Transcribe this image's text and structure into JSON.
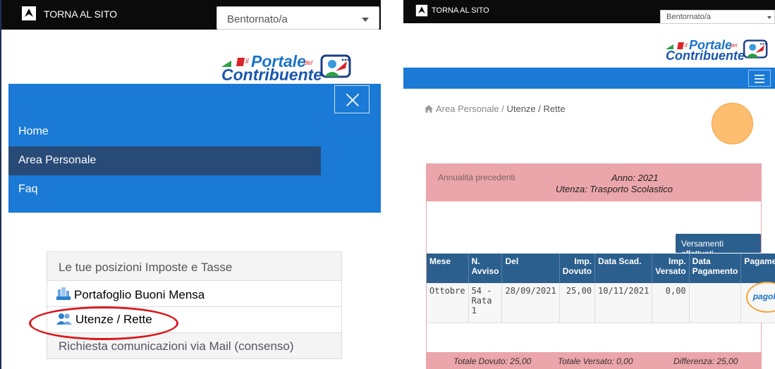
{
  "left": {
    "topbar": {
      "back_label": "TORNA AL SITO",
      "select_value": "Bentornato/a"
    },
    "logo": {
      "il": "il",
      "portale": "Portale",
      "del": "del",
      "contribuente": "Contribuente"
    },
    "menu": {
      "items": [
        {
          "label": "Home"
        },
        {
          "label": "Area Personale"
        },
        {
          "label": "Faq"
        }
      ]
    },
    "tasks": {
      "header": "Le tue posizioni Imposte e Tasse",
      "items": [
        {
          "label": "Portafoglio Buoni Mensa",
          "icon": "building-icon"
        },
        {
          "label": "Utenze / Rette",
          "icon": "users-icon"
        }
      ],
      "consent": "Richiesta comunicazioni via Mail (consenso)"
    }
  },
  "right": {
    "topbar": {
      "back_label": "TORNA AL SITO",
      "select_value": "Bentornato/a"
    },
    "logo": {
      "il": "il",
      "portale": "Portale",
      "del": "del",
      "contribuente": "Contribuente"
    },
    "breadcrumb": {
      "area": "Area Personale",
      "sep": " / ",
      "current": "Utenze / Rette"
    },
    "card": {
      "prev_label": "Annualità precedenti",
      "year": "Anno: 2021",
      "utenza": "Utenza: Trasporto Scolastico",
      "versamenti_button": "Versamenti effettuati",
      "columns": [
        "Mese",
        "N. Avviso",
        "Del",
        "Imp. Dovuto",
        "Data Scad.",
        "Imp. Versato",
        "Data Pagamento",
        "Pagamento"
      ],
      "rows": [
        {
          "mese": "Ottobre",
          "avviso": "54 - Rata 1",
          "del": "28/09/2021",
          "dovuto": "25,00",
          "scad": "10/11/2021",
          "versato": "0,00",
          "data_pag": "",
          "pay": "pagoPA"
        }
      ],
      "footer": {
        "dovuto": "Totale Dovuto: 25,00",
        "versato": "Totale Versato: 0,00",
        "diff": "Differenza: 25,00"
      }
    }
  },
  "colors": {
    "brand_blue": "#1a7ad6",
    "active_nav": "#284a77",
    "table_header": "#2b5f8e",
    "card_pink": "#eba6ab",
    "highlight_red": "#d8191f",
    "pagopa_ring": "#f4a53a"
  }
}
